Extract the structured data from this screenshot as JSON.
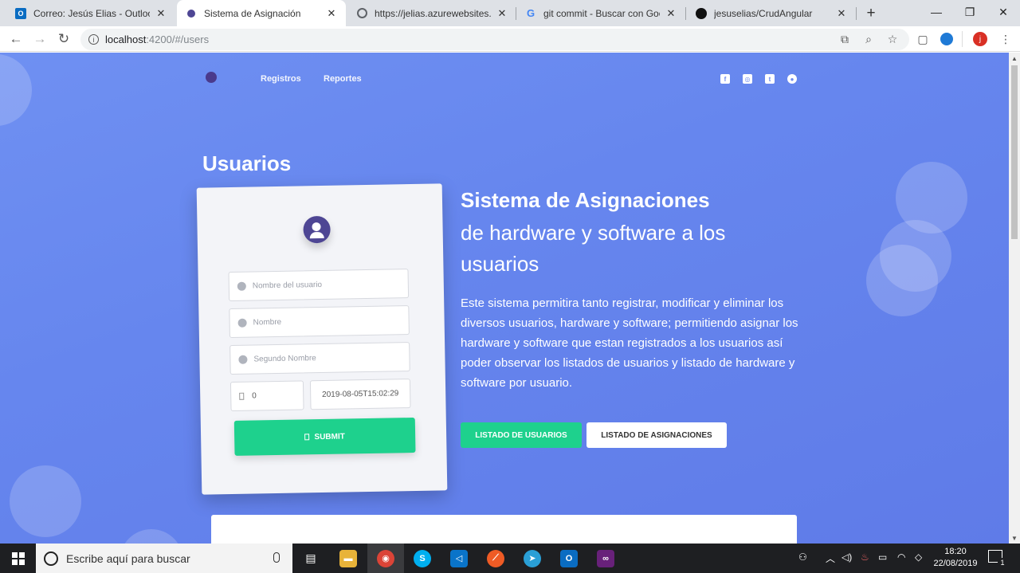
{
  "browser": {
    "tabs": [
      {
        "label": "Correo: Jesús Elias - Outlook",
        "icon": "outlook-icon",
        "color": "#0a6cc2",
        "glyph": "O"
      },
      {
        "label": "Sistema de Asignación",
        "icon": "app-favicon",
        "color": "#4e4694",
        "glyph": "●"
      },
      {
        "label": "https://jelias.azurewebsites.net",
        "icon": "globe-icon",
        "color": "#5f6368",
        "glyph": "◍"
      },
      {
        "label": "git commit - Buscar con Google",
        "icon": "google-icon",
        "color": "#4285f4",
        "glyph": "G"
      },
      {
        "label": "jesuselias/CrudAngular",
        "icon": "github-icon",
        "color": "#111111",
        "glyph": "◉"
      }
    ],
    "new_tab": "+",
    "address": {
      "host": "localhost",
      "path": ":4200/#/users"
    },
    "profile_initial": "j"
  },
  "navbar": {
    "links": [
      "Registros",
      "Reportes"
    ],
    "social": [
      {
        "name": "facebook-icon",
        "glyph": "f"
      },
      {
        "name": "instagram-icon",
        "glyph": "◎"
      },
      {
        "name": "twitter-icon",
        "glyph": "t"
      },
      {
        "name": "github-icon",
        "glyph": "●"
      }
    ]
  },
  "main": {
    "section_title": "Usuarios",
    "form": {
      "username_placeholder": "Nombre del usuario",
      "name_placeholder": "Nombre",
      "second_name_placeholder": "Segundo Nombre",
      "number_value": "0",
      "datetime_value": "2019-08-05T15:02:29",
      "submit_label": "SUBMIT"
    },
    "hero": {
      "title": "Sistema de Asignaciones",
      "subtitle": "de hardware y software a los usuarios",
      "description": "Este sistema permitira tanto registrar, modificar y eliminar los diversos usuarios, hardware y software; permitiendo asignar los hardware y software que estan registrados a los usuarios así poder observar los listados de usuarios y listado de hardware y software por usuario.",
      "btn_users": "LISTADO DE USUARIOS",
      "btn_assignments": "LISTADO DE ASIGNACIONES"
    }
  },
  "taskbar": {
    "search_placeholder": "Escribe aquí para buscar",
    "time": "18:20",
    "date": "22/08/2019",
    "notification_count": "1",
    "apps": [
      {
        "name": "task-view-icon",
        "color": "#1e1f22",
        "glyph": "▤"
      },
      {
        "name": "file-explorer-icon",
        "color": "#e8b339",
        "glyph": "▬"
      },
      {
        "name": "chrome-icon",
        "color": "#db4437",
        "glyph": "◉"
      },
      {
        "name": "skype-icon",
        "color": "#00aff0",
        "glyph": "S"
      },
      {
        "name": "vscode-icon",
        "color": "#0a74c9",
        "glyph": "◁"
      },
      {
        "name": "postman-icon",
        "color": "#ef5b25",
        "glyph": "⟋"
      },
      {
        "name": "teams-icon",
        "color": "#2a9fd6",
        "glyph": "➤"
      },
      {
        "name": "outlook-icon",
        "color": "#0a6cc2",
        "glyph": "O"
      },
      {
        "name": "visual-studio-icon",
        "color": "#68217a",
        "glyph": "∞"
      }
    ]
  }
}
